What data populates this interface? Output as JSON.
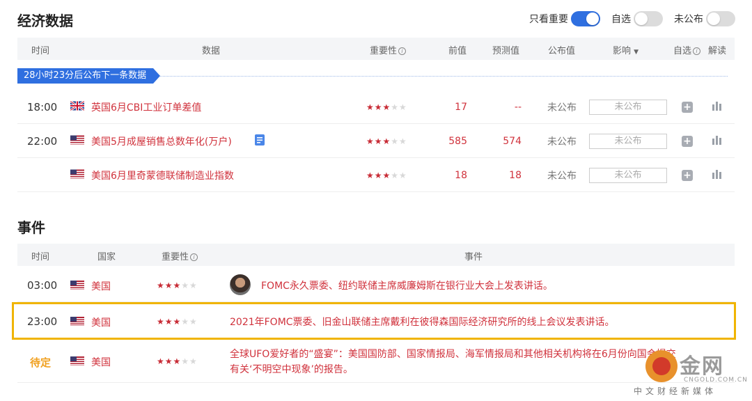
{
  "section1": {
    "title": "经济数据",
    "toggles": [
      {
        "label": "只看重要",
        "on": true
      },
      {
        "label": "自选",
        "on": false
      },
      {
        "label": "未公布",
        "on": false
      }
    ],
    "headers": {
      "time": "时间",
      "data": "数据",
      "importance": "重要性",
      "prev": "前值",
      "forecast": "预测值",
      "actual": "公布值",
      "impact": "影响",
      "watch": "自选",
      "interp": "解读"
    },
    "banner": "28小时23分后公布下一条数据",
    "rows": [
      {
        "time": "18:00",
        "flag": "uk",
        "name": "英国6月CBI工业订单差值",
        "stars": 3,
        "prev": "17",
        "forecast": "--",
        "actual": "未公布",
        "impact": "未公布"
      },
      {
        "time": "22:00",
        "flag": "us",
        "name": "美国5月成屋销售总数年化(万户)",
        "stars": 3,
        "prev": "585",
        "forecast": "574",
        "actual": "未公布",
        "impact": "未公布"
      },
      {
        "time": "",
        "flag": "us",
        "name": "美国6月里奇蒙德联储制造业指数",
        "stars": 3,
        "prev": "18",
        "forecast": "18",
        "actual": "未公布",
        "impact": "未公布"
      }
    ]
  },
  "section2": {
    "title": "事件",
    "headers": {
      "time": "时间",
      "country": "国家",
      "importance": "重要性",
      "event": "事件"
    },
    "rows": [
      {
        "time": "03:00",
        "flag": "us",
        "country": "美国",
        "stars": 3,
        "event": "FOMC永久票委、纽约联储主席威廉姆斯在银行业大会上发表讲话。"
      },
      {
        "time": "23:00",
        "flag": "us",
        "country": "美国",
        "stars": 3,
        "event": "2021年FOMC票委、旧金山联储主席戴利在彼得森国际经济研究所的线上会议发表讲话。"
      },
      {
        "time": "待定",
        "flag": "us",
        "country": "美国",
        "stars": 3,
        "event_line1": "全球UFO爱好者的“盛宴”：美国国防部、国家情报局、海军情报局和其他相关机构将在6月份向国会提交",
        "event_line2": "有关‘不明空中现象’的报告。"
      }
    ]
  },
  "watermark": {
    "brand": "金网",
    "sub": "CNGOLD.COM.CN",
    "foot": "中文财经新媒体"
  },
  "colors": {
    "accent": "#2f6fe0",
    "red": "#d0323c",
    "pending": "#f0a020",
    "highlight": "#f0b400"
  }
}
